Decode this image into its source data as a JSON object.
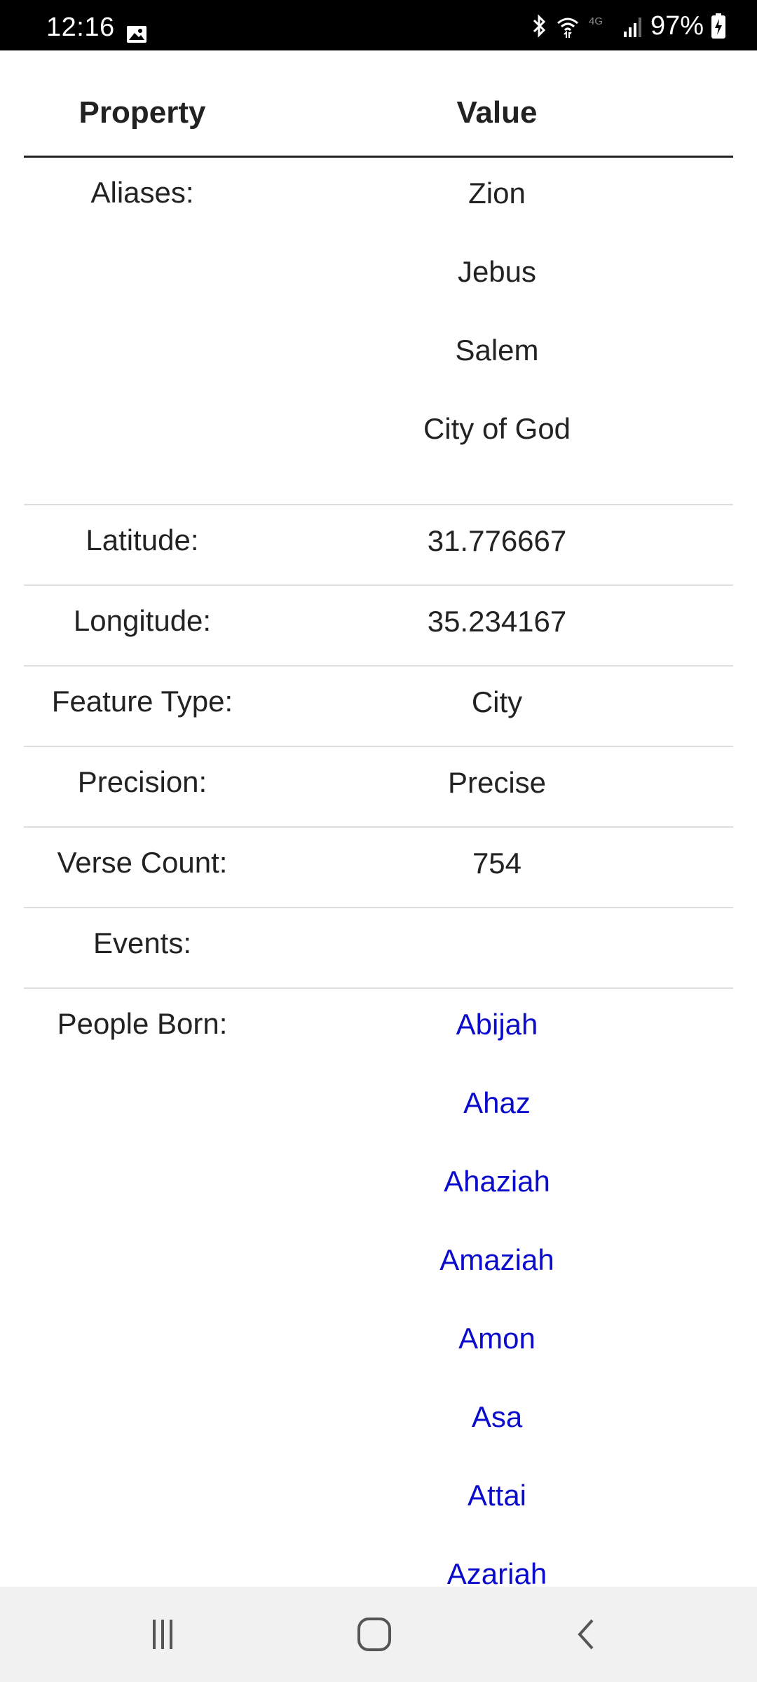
{
  "status_bar": {
    "time": "12:16",
    "battery": "97%",
    "icons": [
      "image-icon",
      "bluetooth-icon",
      "wifi-icon",
      "4g-icon",
      "signal-icon",
      "battery-charging-icon"
    ]
  },
  "table": {
    "header": {
      "property": "Property",
      "value": "Value"
    },
    "rows": {
      "aliases": {
        "label": "Aliases:",
        "values": [
          "Zion",
          "Jebus",
          "Salem",
          "City of God"
        ]
      },
      "latitude": {
        "label": "Latitude:",
        "value": "31.776667"
      },
      "longitude": {
        "label": "Longitude:",
        "value": "35.234167"
      },
      "feature_type": {
        "label": "Feature Type:",
        "value": "City"
      },
      "precision": {
        "label": "Precision:",
        "value": "Precise"
      },
      "verse_count": {
        "label": "Verse Count:",
        "value": "754"
      },
      "events": {
        "label": "Events:",
        "value": ""
      },
      "people_born": {
        "label": "People Born:",
        "values": [
          "Abijah",
          "Ahaz",
          "Ahaziah",
          "Amaziah",
          "Amon",
          "Asa",
          "Attai",
          "Azariah"
        ]
      }
    }
  },
  "colors": {
    "link": "#0b0bcc",
    "status_bar_bg": "#000000",
    "nav_bar_bg": "#f1f1f1"
  },
  "nav_bar": {
    "icons": [
      "recent-apps-icon",
      "home-icon",
      "back-icon"
    ]
  }
}
